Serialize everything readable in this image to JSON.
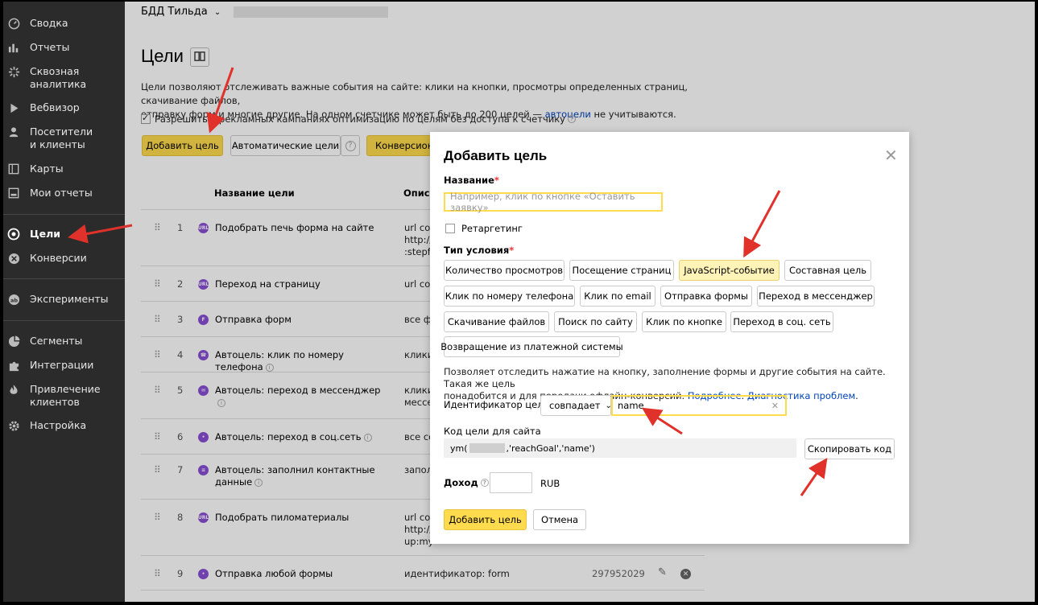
{
  "sidebar": {
    "items": [
      {
        "label": "Сводка",
        "icon": "gauge-icon"
      },
      {
        "label": "Отчеты",
        "icon": "bar-chart-icon"
      },
      {
        "label": "Сквозная\nаналитика",
        "icon": "spark-icon"
      },
      {
        "label": "Вебвизор",
        "icon": "play-icon"
      },
      {
        "label": "Посетители\nи клиенты",
        "icon": "person-icon"
      },
      {
        "label": "Карты",
        "icon": "map-icon"
      },
      {
        "label": "Мои отчеты",
        "icon": "inbox-icon"
      },
      {
        "label": "Цели",
        "icon": "target-icon"
      },
      {
        "label": "Конверсии",
        "icon": "conversion-icon"
      },
      {
        "label": "Эксперименты",
        "icon": "ab-icon"
      },
      {
        "label": "Сегменты",
        "icon": "pie-icon"
      },
      {
        "label": "Интеграции",
        "icon": "puzzle-icon"
      },
      {
        "label": "Привлечение\nклиентов",
        "icon": "flame-icon"
      },
      {
        "label": "Настройка",
        "icon": "gear-icon"
      }
    ]
  },
  "header": {
    "counter_name": "БДД Тильда"
  },
  "page": {
    "title": "Цели",
    "desc_1": "Цели позволяют отслеживать важные события на сайте: клики на кнопки, просмотры определенных страниц, скачивание файлов,",
    "desc_2a": "отправку форм и многие другие. На одном счетчике может быть до 200 целей — ",
    "desc_link": "автоцели",
    "desc_2b": " не учитываются.",
    "checkbox_label": "Разрешить в рекламных кампаниях оптимизацию по целям без доступа к счетчику",
    "add_goal_btn": "Добавить цель",
    "auto_goals_btn": "Автоматические цели",
    "conversion_btn": "Конверсионн",
    "col_name": "Название цели",
    "col_desc": "Описа"
  },
  "goals": [
    {
      "num": "1",
      "icon_text": "URL",
      "name": "Подобрать печь форма на сайте",
      "cond": "url со\nhttp://\n:stepf"
    },
    {
      "num": "2",
      "icon_text": "URL",
      "name": "Переход на страницу",
      "cond": "url со"
    },
    {
      "num": "3",
      "icon_text": "F",
      "name": "Отправка форм",
      "cond": "все фо"
    },
    {
      "num": "4",
      "icon_text": "☎",
      "name": "Автоцель: клик по номеру телефона",
      "cond": "клики"
    },
    {
      "num": "5",
      "icon_text": "✉",
      "name": "Автоцель: переход в мессенджер",
      "cond": "клики\nмессе"
    },
    {
      "num": "6",
      "icon_text": "•",
      "name": "Автоцель: переход в соц.сеть",
      "cond": "все со"
    },
    {
      "num": "7",
      "icon_text": "≡",
      "name": "Автоцель: заполнил контактные\nданные",
      "cond": "запол"
    },
    {
      "num": "8",
      "icon_text": "URL",
      "name": "Подобрать пиломатериалы",
      "cond": "url со\nhttp://\nup:my"
    },
    {
      "num": "9",
      "icon_text": "•",
      "name": "Отправка любой формы",
      "cond": "идентификатор: form",
      "id": "297952029"
    }
  ],
  "modal": {
    "title": "Добавить цель",
    "name_label": "Название",
    "name_placeholder": "Например, клик по кнопке «Оставить заявку»",
    "retargeting": "Ретаргетинг",
    "cond_type_label": "Тип условия",
    "types": [
      "Количество просмотров",
      "Посещение страниц",
      "JavaScript-событие",
      "Составная цель",
      "Клик по номеру телефона",
      "Клик по email",
      "Отправка формы",
      "Переход в мессенджер",
      "Скачивание файлов",
      "Поиск по сайту",
      "Клик по кнопке",
      "Переход в соц. сеть",
      "Возвращение из платежной системы"
    ],
    "hint_1": "Позволяет отследить нажатие на кнопку, заполнение формы и другие события на сайте. Такая же цель",
    "hint_2a": "понадобится и для передачи офлайн-конверсий. ",
    "hint_link1": "Подробнее",
    "hint_dot": ". ",
    "hint_link2": "Диагностика проблем",
    "hint_end": ".",
    "id_label": "Идентификатор цели:",
    "match_select": "совпадает",
    "id_value": "name",
    "code_label": "Код цели для сайта",
    "code_prefix": "ym(",
    "code_suffix": ",'reachGoal','name')",
    "copy_btn": "Скопировать код",
    "income_label": "Доход",
    "currency": "RUB",
    "submit_btn": "Добавить цель",
    "cancel_btn": "Отмена"
  },
  "colors": {
    "accent_yellow": "#ffdb4d",
    "arrow_red": "#e0312b",
    "sidebar_bg": "#2b2b2b",
    "link": "#0044bb"
  }
}
